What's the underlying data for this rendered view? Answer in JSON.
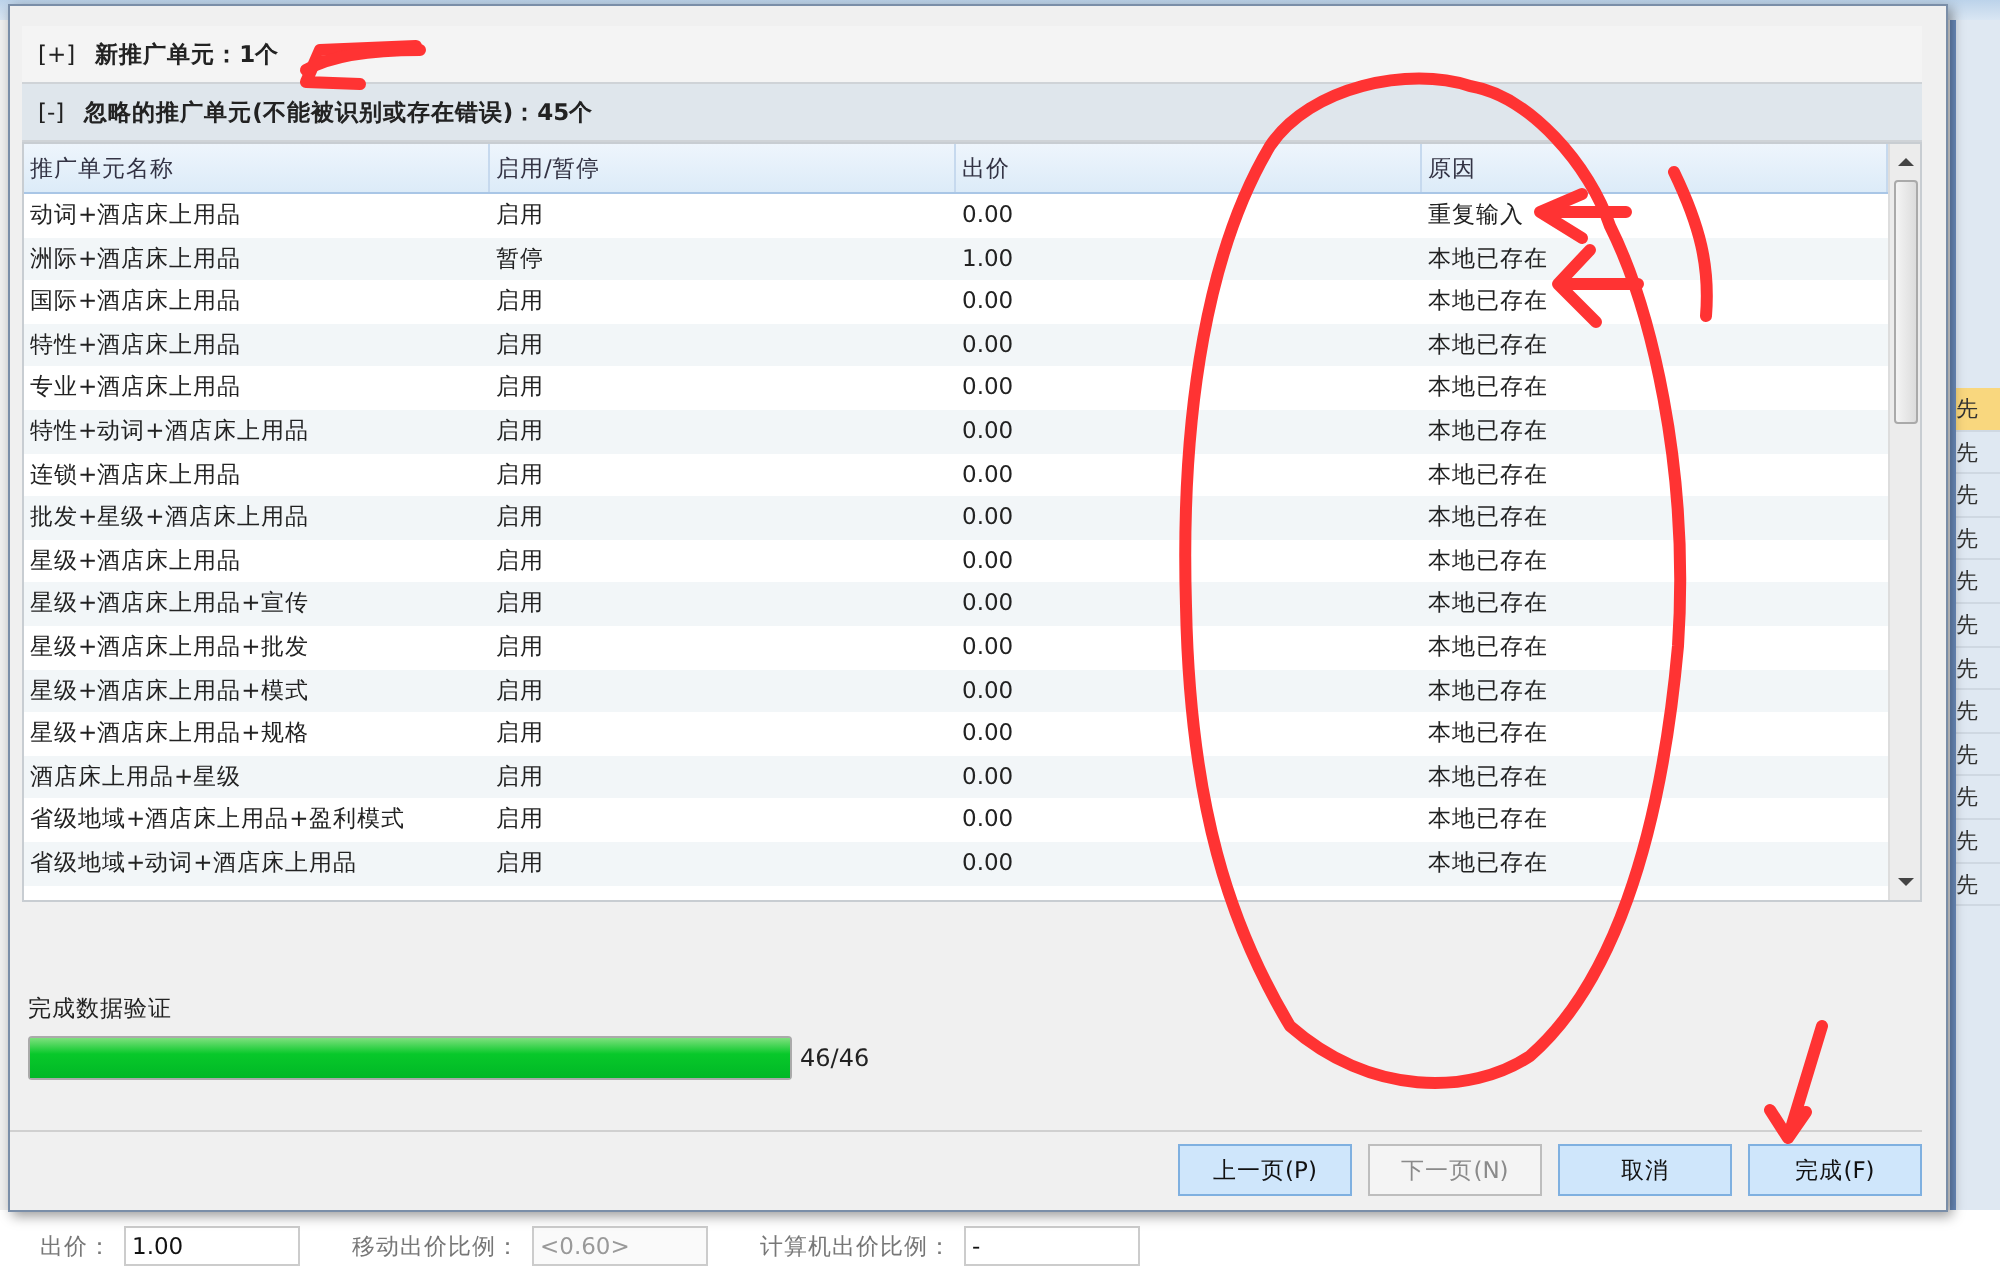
{
  "dialog": {
    "sections": [
      {
        "toggle": "[+]",
        "title": "新推广单元：1个",
        "expanded": false
      },
      {
        "toggle": "[-]",
        "title": "忽略的推广单元(不能被识别或存在错误)：45个",
        "expanded": true
      }
    ],
    "table": {
      "columns": [
        "推广单元名称",
        "启用/暂停",
        "出价",
        "原因"
      ],
      "rows": [
        {
          "name": "动词+酒店床上用品",
          "status": "启用",
          "bid": "0.00",
          "reason": "重复输入"
        },
        {
          "name": "洲际+酒店床上用品",
          "status": "暂停",
          "bid": "1.00",
          "reason": "本地已存在"
        },
        {
          "name": "国际+酒店床上用品",
          "status": "启用",
          "bid": "0.00",
          "reason": "本地已存在"
        },
        {
          "name": "特性+酒店床上用品",
          "status": "启用",
          "bid": "0.00",
          "reason": "本地已存在"
        },
        {
          "name": "专业+酒店床上用品",
          "status": "启用",
          "bid": "0.00",
          "reason": "本地已存在"
        },
        {
          "name": "特性+动词+酒店床上用品",
          "status": "启用",
          "bid": "0.00",
          "reason": "本地已存在"
        },
        {
          "name": "连锁+酒店床上用品",
          "status": "启用",
          "bid": "0.00",
          "reason": "本地已存在"
        },
        {
          "name": "批发+星级+酒店床上用品",
          "status": "启用",
          "bid": "0.00",
          "reason": "本地已存在"
        },
        {
          "name": "星级+酒店床上用品",
          "status": "启用",
          "bid": "0.00",
          "reason": "本地已存在"
        },
        {
          "name": "星级+酒店床上用品+宣传",
          "status": "启用",
          "bid": "0.00",
          "reason": "本地已存在"
        },
        {
          "name": "星级+酒店床上用品+批发",
          "status": "启用",
          "bid": "0.00",
          "reason": "本地已存在"
        },
        {
          "name": "星级+酒店床上用品+模式",
          "status": "启用",
          "bid": "0.00",
          "reason": "本地已存在"
        },
        {
          "name": "星级+酒店床上用品+规格",
          "status": "启用",
          "bid": "0.00",
          "reason": "本地已存在"
        },
        {
          "name": "酒店床上用品+星级",
          "status": "启用",
          "bid": "0.00",
          "reason": "本地已存在"
        },
        {
          "name": "省级地域+酒店床上用品+盈利模式",
          "status": "启用",
          "bid": "0.00",
          "reason": "本地已存在"
        },
        {
          "name": "省级地域+动词+酒店床上用品",
          "status": "启用",
          "bid": "0.00",
          "reason": "本地已存在"
        }
      ]
    },
    "progress": {
      "label": "完成数据验证",
      "level": 1.0,
      "reading": "46/46"
    },
    "buttons": [
      {
        "label": "上一页(P)",
        "disabled": false
      },
      {
        "label": "下一页(N)",
        "disabled": true
      },
      {
        "label": "取消",
        "disabled": false
      },
      {
        "label": "完成(F)",
        "disabled": false
      }
    ]
  },
  "background": {
    "side_cells": [
      {
        "text": "先",
        "selected": true
      },
      {
        "text": "先",
        "selected": false
      },
      {
        "text": "先",
        "selected": false
      },
      {
        "text": "先",
        "selected": false
      },
      {
        "text": "先",
        "selected": false
      },
      {
        "text": "先",
        "selected": false
      },
      {
        "text": "先",
        "selected": false
      },
      {
        "text": "先",
        "selected": false
      },
      {
        "text": "先",
        "selected": false
      },
      {
        "text": "先",
        "selected": false
      },
      {
        "text": "先",
        "selected": false
      },
      {
        "text": "先",
        "selected": false
      }
    ],
    "fields": [
      {
        "label": "出价：",
        "value": "1.00",
        "disabled": false
      },
      {
        "label": "移动出价比例：",
        "value": "<0.60>",
        "disabled": true
      },
      {
        "label": "计算机出价比例：",
        "value": "-",
        "disabled": false
      }
    ]
  }
}
